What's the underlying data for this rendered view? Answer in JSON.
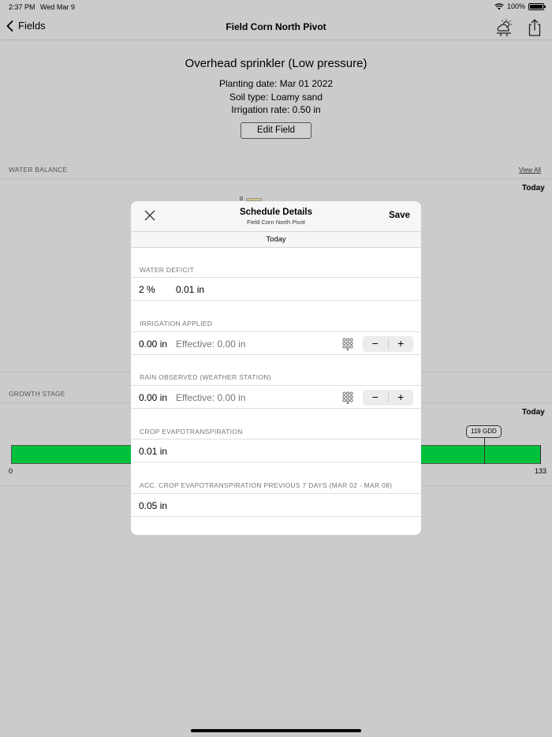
{
  "status_bar": {
    "time": "2:37 PM",
    "date": "Wed Mar 9",
    "battery": "100%"
  },
  "nav": {
    "back_label": "Fields",
    "title": "Field Corn North Pivot"
  },
  "field": {
    "title": "Overhead sprinkler (Low pressure)",
    "planting_date": "Planting date: Mar 01 2022",
    "soil_type": "Soil type: Loamy sand",
    "irrigation_rate": "Irrigation rate: 0.50 in",
    "edit_label": "Edit Field"
  },
  "water_balance": {
    "label": "WATER BALANCE",
    "view_all": "View All",
    "today": "Today",
    "partial_value": "0"
  },
  "growth_stage": {
    "label": "GROWTH STAGE",
    "today": "Today",
    "gdd_badge": "119 GDD",
    "min_label": "0",
    "max_label": "133",
    "current_gdd": 119,
    "max_gdd": 133,
    "bar_color": "#00c13c"
  },
  "modal": {
    "title": "Schedule Details",
    "subtitle": "Field Corn North Pivot",
    "save_label": "Save",
    "day_label": "Today",
    "water_deficit": {
      "label": "WATER DEFICIT",
      "percent": "2 %",
      "value": "0.01 in"
    },
    "irrigation_applied": {
      "label": "IRRIGATION APPLIED",
      "value": "0.00 in",
      "effective_placeholder": "Effective: 0.00 in"
    },
    "rain_observed": {
      "label": "RAIN OBSERVED (WEATHER STATION)",
      "value": "0.00 in",
      "effective_placeholder": "Effective: 0.00 in"
    },
    "crop_et": {
      "label": "CROP EVAPOTRANSPIRATION",
      "value": "0.01 in"
    },
    "acc_crop_et": {
      "label": "ACC. CROP EVAPOTRANSPIRATION PREVIOUS 7 DAYS (MAR 02 - MAR 08)",
      "value": "0.05 in"
    },
    "stepper_minus": "−",
    "stepper_plus": "+"
  },
  "icons": [
    "chevron-left-icon",
    "weather-icon",
    "share-icon",
    "wifi-icon",
    "battery-icon",
    "close-icon",
    "keypad-icon"
  ]
}
